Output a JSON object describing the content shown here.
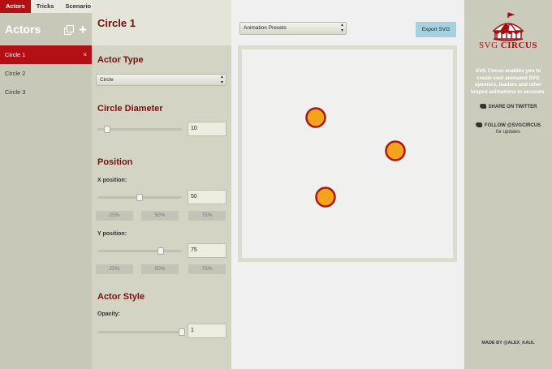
{
  "tabs": [
    {
      "label": "Actors",
      "active": true
    },
    {
      "label": "Tricks",
      "active": false
    },
    {
      "label": "Scenario",
      "active": false
    }
  ],
  "sidebar": {
    "title": "Actors",
    "actors": [
      {
        "label": "Circle 1",
        "selected": true,
        "close_glyph": "×"
      },
      {
        "label": "Circle 2",
        "selected": false
      },
      {
        "label": "Circle 3",
        "selected": false
      }
    ]
  },
  "props": {
    "title": "Circle 1",
    "actor_type": {
      "heading": "Actor Type",
      "value": "Circle"
    },
    "diameter": {
      "heading": "Circle Diameter",
      "value": "10",
      "slider_fraction": 0.12
    },
    "position": {
      "heading": "Position",
      "x": {
        "label": "X position:",
        "value": "50",
        "slider_fraction": 0.5
      },
      "y": {
        "label": "Y position:",
        "value": "75",
        "slider_fraction": 0.75
      },
      "presets": [
        "25%",
        "50%",
        "75%"
      ]
    },
    "style": {
      "heading": "Actor Style",
      "opacity": {
        "label": "Opacity:",
        "value": "1",
        "slider_fraction": 1.0
      }
    }
  },
  "stage": {
    "preset_select": "Animation Presets",
    "export_label": "Export SVG",
    "circle_fill": "#f5a31a",
    "circle_stroke": "#a81818"
  },
  "info": {
    "logo_word1": "SVG",
    "logo_word2": "CIRCUS",
    "blurb": "SVG Circus enables you to create cool animated SVG spinners, loaders and other looped animations in seconds.",
    "twitter_share": "SHARE ON TWITTER",
    "follow_line1": "FOLLOW @SVGCIRCUS",
    "follow_line2": "for updates",
    "credit": "MADE BY @ALEX_KAUL"
  },
  "colors": {
    "accent": "#b50f16",
    "heading": "#7a0f0f",
    "export_button": "#a5d1e1"
  },
  "icons": [
    "duplicate-icon",
    "plus-icon",
    "close-icon",
    "select-arrows-icon",
    "twitter-icon",
    "circus-tent-logo"
  ]
}
